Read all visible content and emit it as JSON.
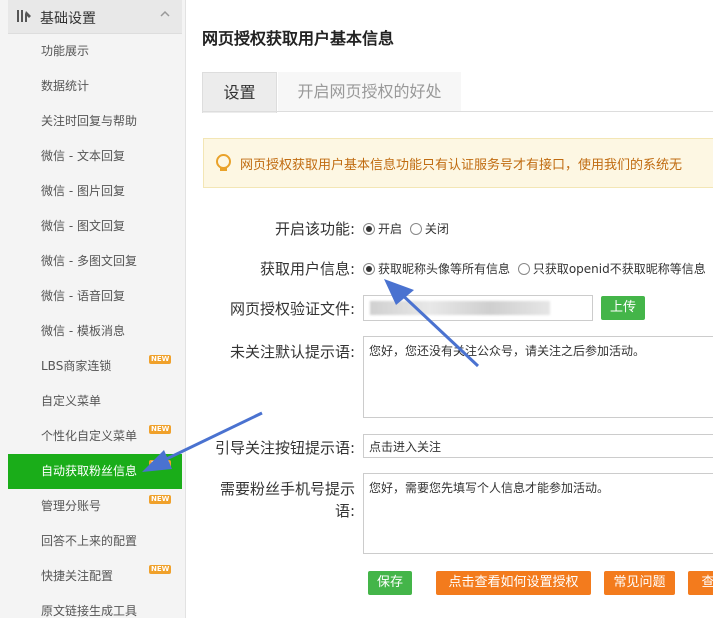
{
  "sidebar": {
    "section_title": "基础设置",
    "items": [
      {
        "label": "功能展示",
        "new": false,
        "active": false
      },
      {
        "label": "数据统计",
        "new": false,
        "active": false
      },
      {
        "label": "关注时回复与帮助",
        "new": false,
        "active": false
      },
      {
        "label": "微信 - 文本回复",
        "new": false,
        "active": false
      },
      {
        "label": "微信 - 图片回复",
        "new": false,
        "active": false
      },
      {
        "label": "微信 - 图文回复",
        "new": false,
        "active": false
      },
      {
        "label": "微信 - 多图文回复",
        "new": false,
        "active": false
      },
      {
        "label": "微信 - 语音回复",
        "new": false,
        "active": false
      },
      {
        "label": "微信 - 模板消息",
        "new": false,
        "active": false
      },
      {
        "label": "LBS商家连锁",
        "new": true,
        "active": false
      },
      {
        "label": "自定义菜单",
        "new": false,
        "active": false
      },
      {
        "label": "个性化自定义菜单",
        "new": true,
        "active": false
      },
      {
        "label": "自动获取粉丝信息",
        "new": true,
        "active": true
      },
      {
        "label": "管理分账号",
        "new": true,
        "active": false
      },
      {
        "label": "回答不上来的配置",
        "new": false,
        "active": false
      },
      {
        "label": "快捷关注配置",
        "new": true,
        "active": false
      },
      {
        "label": "原文链接生成工具",
        "new": false,
        "active": false
      }
    ],
    "badge_text": "NEW"
  },
  "main": {
    "title": "网页授权获取用户基本信息",
    "tabs": [
      {
        "label": "设置",
        "active": true
      },
      {
        "label": "开启网页授权的好处",
        "active": false
      }
    ],
    "notice": "网页授权获取用户基本信息功能只有认证服务号才有接口，使用我们的系统无",
    "form": {
      "enable_label": "开启该功能:",
      "enable_options": [
        "开启",
        "关闭"
      ],
      "enable_selected": "开启",
      "info_label": "获取用户信息:",
      "info_options": [
        "获取昵称头像等所有信息",
        "只获取openid不获取昵称等信息"
      ],
      "info_selected": "获取昵称头像等所有信息",
      "file_label": "网页授权验证文件:",
      "upload_button": "上传",
      "default_prompt_label": "未关注默认提示语:",
      "default_prompt_value": "您好，您还没有关注公众号，请关注之后参加活动。",
      "guide_label": "引导关注按钮提示语:",
      "guide_value": "点击进入关注",
      "phone_label_line1": "需要粉丝手机号提示",
      "phone_label_line2": "语:",
      "phone_value": "您好，需要您先填写个人信息才能参加活动。"
    },
    "actions": {
      "save": "保存",
      "how_to": "点击查看如何设置授权",
      "faq": "常见问题",
      "more": "查"
    }
  },
  "colors": {
    "active_green": "#1aad19",
    "button_green": "#44b549",
    "button_orange": "#f37b1d",
    "badge_orange": "#f0a12b",
    "annotation_arrow": "#4a72d0"
  }
}
